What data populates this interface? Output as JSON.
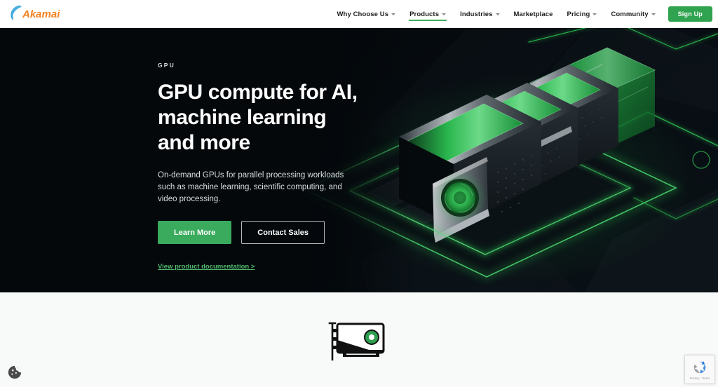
{
  "brand": {
    "logo_text": "Akamai",
    "logo_color": "#f58220",
    "logo_arc_color": "#2e9bd6"
  },
  "nav": {
    "items": [
      {
        "label": "Why Choose Us",
        "has_caret": true,
        "active": false
      },
      {
        "label": "Products",
        "has_caret": true,
        "active": true
      },
      {
        "label": "Industries",
        "has_caret": true,
        "active": false
      },
      {
        "label": "Marketplace",
        "has_caret": false,
        "active": false
      },
      {
        "label": "Pricing",
        "has_caret": true,
        "active": false
      },
      {
        "label": "Community",
        "has_caret": true,
        "active": false
      }
    ],
    "signup_label": "Sign Up",
    "signup_color": "#2fa34f",
    "active_underline_color": "#3dae5f"
  },
  "hero": {
    "eyebrow": "GPU",
    "title": "GPU compute for AI, machine learning and more",
    "title_lines": [
      "GPU compute for AI,",
      "machine learning",
      "and more"
    ],
    "description": "On-demand GPUs for parallel processing workloads such as machine learning, scientific computing, and video processing.",
    "primary_button": "Learn More",
    "secondary_button": "Contact Sales",
    "doc_link": "View product documentation >",
    "background_color": "#04080b",
    "accent_green": "#3aab5d",
    "art_alt": "isometric-gpu-cards-illustration"
  },
  "lower_section": {
    "background_color": "#f8f9f9",
    "icon_name": "gpu-card-icon",
    "icon_accent_color": "#2e9e4f"
  },
  "badges": {
    "cookie_icon_name": "cookie-consent-icon",
    "recaptcha_privacy": "Privacy",
    "recaptcha_separator": " - ",
    "recaptcha_terms": "Terms",
    "recaptcha_text": "Privacy - Terms"
  }
}
